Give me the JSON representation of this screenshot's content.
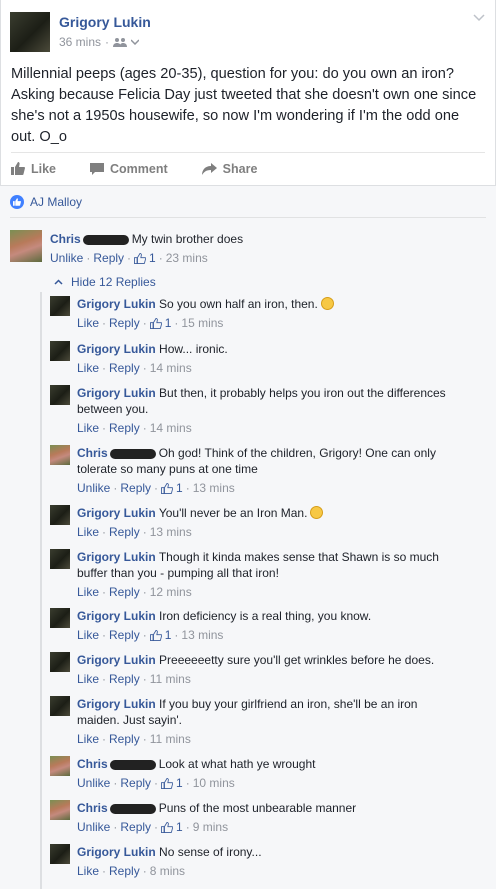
{
  "post": {
    "author": "Grigory Lukin",
    "time": "36 mins",
    "text": "Millennial peeps (ages 20-35), question for you: do you own an iron? Asking because Felicia Day just tweeted that she doesn't own one since she's not a 1950s housewife, so now I'm wondering if I'm the odd one out. O_o",
    "actions": {
      "like": "Like",
      "comment": "Comment",
      "share": "Share"
    }
  },
  "likes": {
    "names": "AJ Malloy"
  },
  "top_comment": {
    "author": "Chris",
    "text": "My twin brother does",
    "unlike": "Unlike",
    "reply": "Reply",
    "likes": "1",
    "time": "23 mins"
  },
  "hide_replies": "Hide 12 Replies",
  "replies": [
    {
      "author": "Grigory Lukin",
      "text": "So you own half an iron, then.",
      "like": "Like",
      "reply": "Reply",
      "likes": "1",
      "time": "15 mins"
    },
    {
      "author": "Grigory Lukin",
      "text": "How... ironic.",
      "like": "Like",
      "reply": "Reply",
      "likes": "",
      "time": "14 mins"
    },
    {
      "author": "Grigory Lukin",
      "text": "But then, it probably helps you iron out the differences between you.",
      "like": "Like",
      "reply": "Reply",
      "likes": "",
      "time": "14 mins"
    },
    {
      "author": "Chris",
      "text": "Oh god! Think of the children, Grigory! One can only tolerate so many puns at one time",
      "like": "Unlike",
      "reply": "Reply",
      "likes": "1",
      "time": "13 mins"
    },
    {
      "author": "Grigory Lukin",
      "text": "You'll never be an Iron Man.",
      "like": "Like",
      "reply": "Reply",
      "likes": "",
      "time": "13 mins"
    },
    {
      "author": "Grigory Lukin",
      "text": "Though it kinda makes sense that Shawn is so much buffer than you - pumping all that iron!",
      "like": "Like",
      "reply": "Reply",
      "likes": "",
      "time": "12 mins"
    },
    {
      "author": "Grigory Lukin",
      "text": "Iron deficiency is a real thing, you know.",
      "like": "Like",
      "reply": "Reply",
      "likes": "1",
      "time": "13 mins"
    },
    {
      "author": "Grigory Lukin",
      "text": "Preeeeeetty sure you'll get wrinkles before he does.",
      "like": "Like",
      "reply": "Reply",
      "likes": "",
      "time": "11 mins"
    },
    {
      "author": "Grigory Lukin",
      "text": "If you buy your girlfriend an iron, she'll be an iron maiden. Just sayin'.",
      "like": "Like",
      "reply": "Reply",
      "likes": "",
      "time": "11 mins"
    },
    {
      "author": "Chris",
      "text": "Look at what hath ye wrought",
      "like": "Unlike",
      "reply": "Reply",
      "likes": "1",
      "time": "10 mins"
    },
    {
      "author": "Chris",
      "text": "Puns of the most unbearable manner",
      "like": "Unlike",
      "reply": "Reply",
      "likes": "1",
      "time": "9 mins"
    },
    {
      "author": "Grigory Lukin",
      "text": "No sense of irony...",
      "like": "Like",
      "reply": "Reply",
      "likes": "",
      "time": "8 mins"
    }
  ],
  "colors": {
    "link": "#365899",
    "meta": "#90949c",
    "like_blue": "#4080ff"
  }
}
